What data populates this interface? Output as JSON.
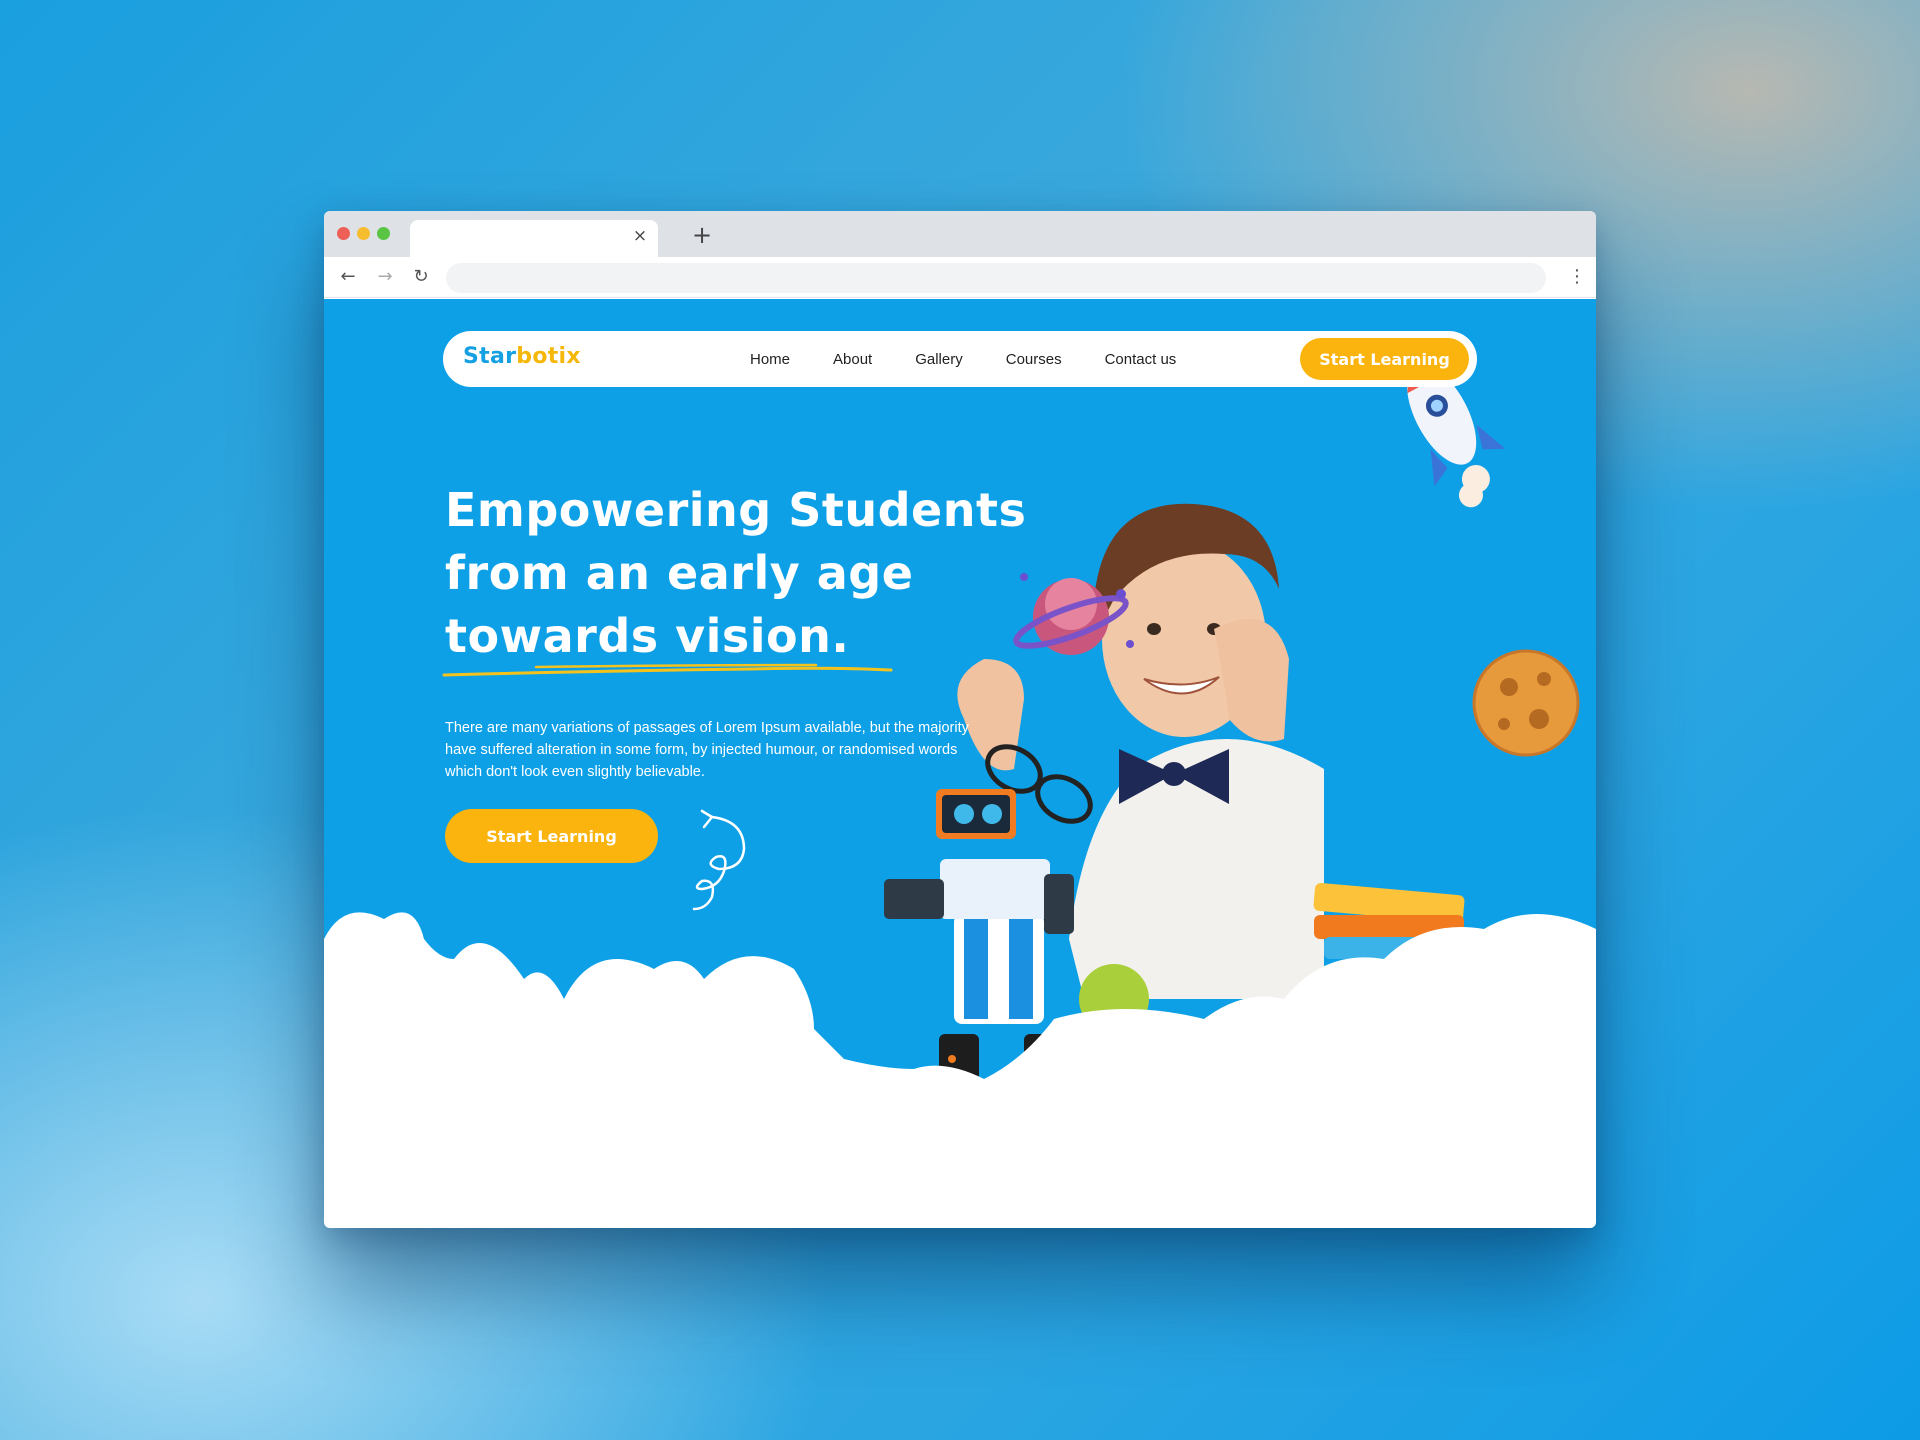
{
  "browser": {
    "tab_close_icon": "×",
    "new_tab_icon": "+",
    "back_icon": "←",
    "forward_icon": "→",
    "reload_icon": "↻",
    "menu_icon": "⋮"
  },
  "site": {
    "logo_part1": "Star",
    "logo_part2": "botix",
    "nav": [
      "Home",
      "About",
      "Gallery",
      "Courses",
      "Contact us"
    ],
    "header_cta": "Start Learning"
  },
  "hero": {
    "title_lines": [
      "Empowering Students",
      "from an early age",
      "towards vision."
    ],
    "description": "There are many variations of passages of Lorem Ipsum available, but the majority have suffered alteration in some form, by injected humour, or randomised words which don't look even slightly believable.",
    "cta": "Start Learning"
  },
  "colors": {
    "primary_blue": "#0ea0e7",
    "accent_yellow": "#fbb40e",
    "logo_blue": "#14a1e3",
    "logo_yellow": "#f6b70b"
  }
}
